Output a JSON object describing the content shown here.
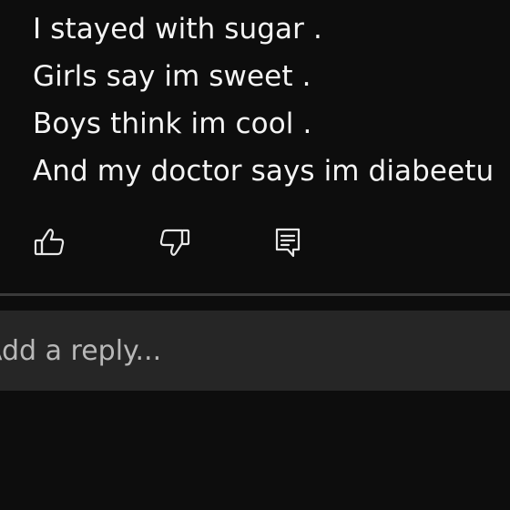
{
  "comment": {
    "lines": [
      "I stayed with sugar .",
      "Girls say im sweet .",
      "Boys think im cool .",
      "And my doctor says im diabeetu"
    ]
  },
  "actions": {
    "like_icon": "thumbs-up-icon",
    "dislike_icon": "thumbs-down-icon",
    "reply_icon": "comment-icon"
  },
  "reply_box": {
    "placeholder": "Add a reply..."
  },
  "colors": {
    "background": "#0d0d0d",
    "text": "#f4f4f4",
    "reply_box": "#262626",
    "divider": "#3a3a3a"
  }
}
